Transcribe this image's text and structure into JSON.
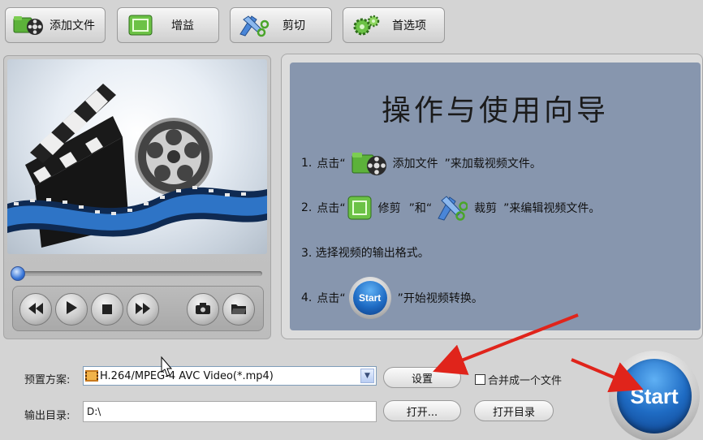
{
  "toolbar": {
    "add_file": "添加文件",
    "gain": "增益",
    "cut": "剪切",
    "preferences": "首选项"
  },
  "player": {
    "seek_fraction": 0.0
  },
  "guide": {
    "title": "操作与使用向导",
    "step1": {
      "num": "1.",
      "pre": "点击“",
      "label": "添加文件",
      "post": "”来加载视频文件。"
    },
    "step2": {
      "num": "2.",
      "pre": "点击“",
      "label1": "修剪",
      "mid": "”和“",
      "label2": "裁剪",
      "post": "”来编辑视频文件。"
    },
    "step3": {
      "text": "3. 选择视频的输出格式。"
    },
    "step4": {
      "num": "4.",
      "pre": "点击“",
      "start": "Start",
      "post": "”开始视频转换。"
    }
  },
  "form": {
    "preset_label": "预置方案:",
    "preset_value": "H.264/MPEG-4 AVC Video(*.mp4)",
    "settings_button": "设置",
    "merge_label": "合并成一个文件",
    "output_label": "输出目录:",
    "output_value": "D:\\",
    "open_button": "打开...",
    "open_dir_button": "打开目录"
  },
  "start_button": "Start",
  "colors": {
    "guide_bg": "#8796ae",
    "start_blue": "#1f6cc4",
    "annotation_red": "#e0241b",
    "toolbar_icon_green": "#5cb23a"
  },
  "icons": [
    "film-reel-icon",
    "gain-icon",
    "scissors-icon",
    "gears-icon",
    "rewind-icon",
    "play-icon",
    "stop-icon",
    "fast-forward-icon",
    "camera-icon",
    "folder-icon"
  ]
}
